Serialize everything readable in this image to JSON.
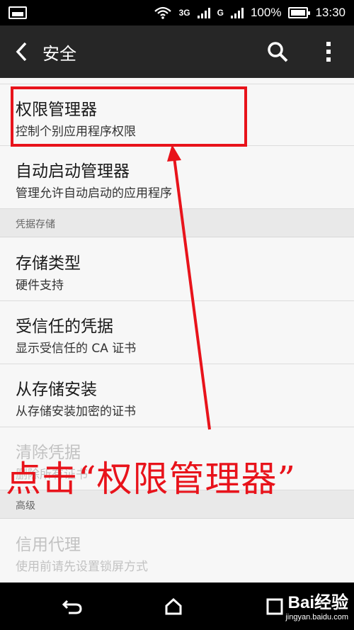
{
  "status_bar": {
    "net_3g": "3G",
    "net_g": "G",
    "battery_pct": "100%",
    "time": "13:30"
  },
  "action_bar": {
    "title": "安全"
  },
  "list": {
    "items": [
      {
        "title": "权限管理器",
        "subtitle": "控制个别应用程序权限"
      },
      {
        "title": "自动启动管理器",
        "subtitle": "管理允许自动启动的应用程序"
      }
    ],
    "section_credentials": "凭据存储",
    "credential_items": [
      {
        "title": "存储类型",
        "subtitle": "硬件支持"
      },
      {
        "title": "受信任的凭据",
        "subtitle": "显示受信任的 CA 证书"
      },
      {
        "title": "从存储安装",
        "subtitle": "从存储安装加密的证书"
      },
      {
        "title": "清除凭据",
        "subtitle": "删除所有证书"
      }
    ],
    "section_advanced": "高级",
    "advanced_items": [
      {
        "title": "信用代理",
        "subtitle": "使用前请先设置锁屏方式"
      }
    ]
  },
  "annotation": {
    "text": "点击“权限管理器”",
    "color": "#e8131b"
  },
  "watermark": {
    "brand": "Bai经验",
    "url": "jingyan.baidu.com"
  }
}
